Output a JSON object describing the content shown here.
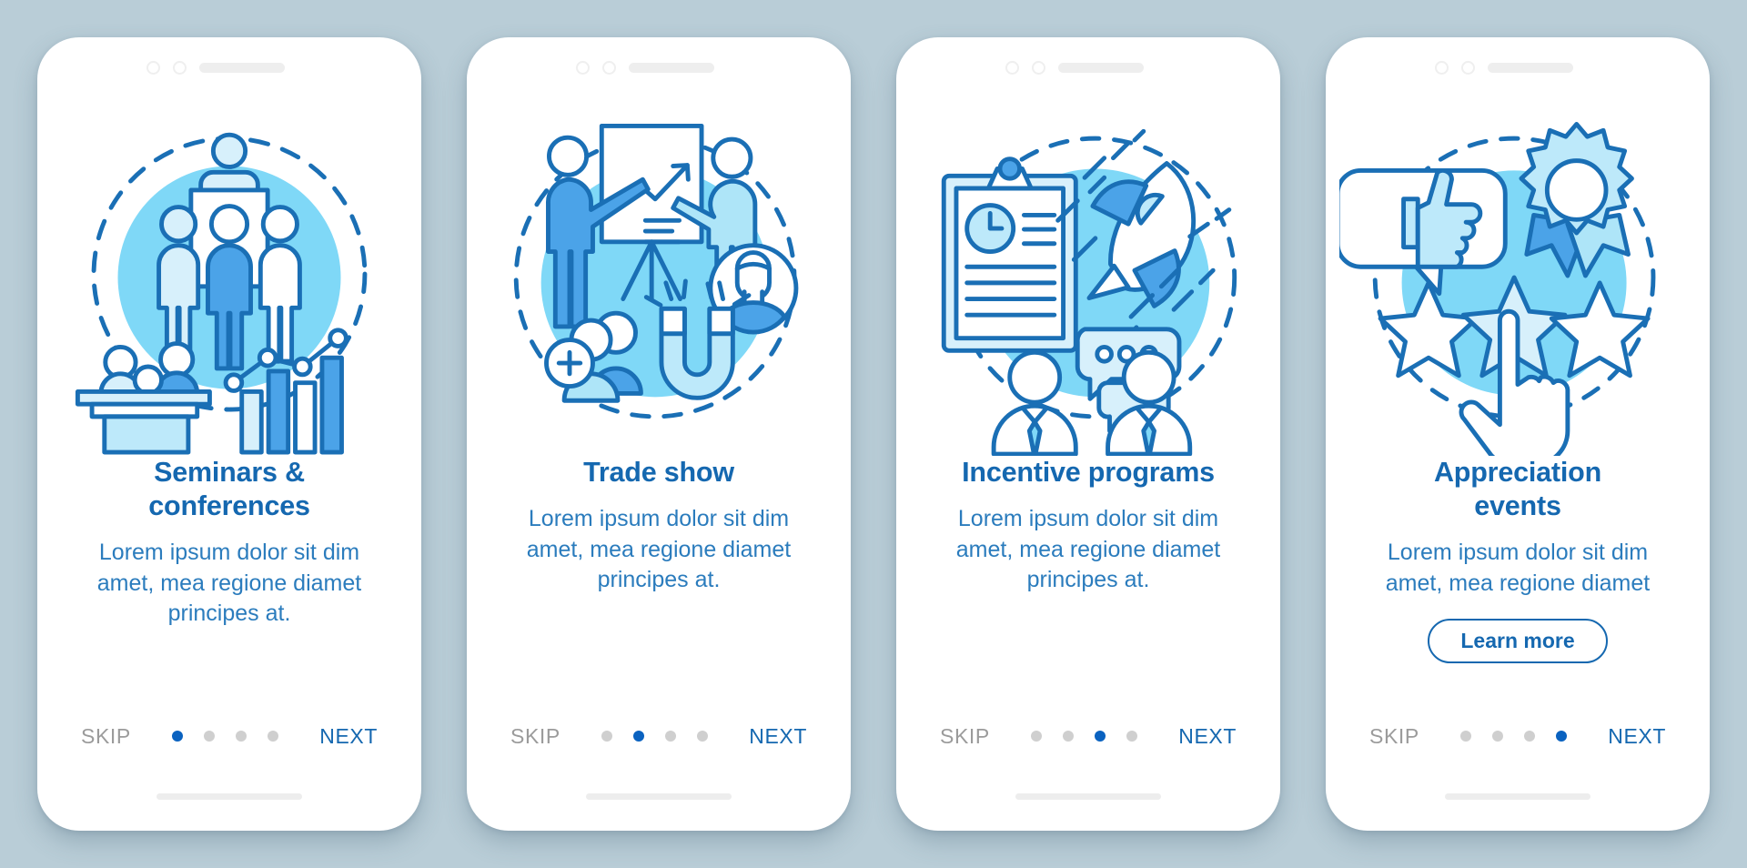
{
  "theme": {
    "background": "#b9cdd7",
    "card_background": "#ffffff",
    "accent": "#1568b0",
    "accent_bright": "#0a62c0",
    "body_text": "#2b7cbd",
    "muted_text": "#9b9b9b",
    "illustration_stroke": "#1a6fb5",
    "illustration_fill_light": "#d7f0fb",
    "illustration_fill_mid": "#7fd8f7",
    "illustration_fill_strong": "#4ba3e8"
  },
  "screens": [
    {
      "id": "seminars-conferences",
      "illustration": "seminars-conferences-illustration",
      "title": "Seminars & conferences",
      "title_lines": [
        "Seminars &",
        "conferences"
      ],
      "description": "Lorem ipsum dolor sit dim amet, mea regione diamet principes at.",
      "description_lines": [
        "Lorem ipsum dolor sit dim",
        "amet, mea regione diamet",
        "principes at."
      ],
      "skip_label": "SKIP",
      "next_label": "NEXT",
      "dots_total": 4,
      "dot_active_index": 0,
      "has_learn_more": false,
      "learn_more_label": ""
    },
    {
      "id": "trade-show",
      "illustration": "trade-show-illustration",
      "title": "Trade show",
      "title_lines": [
        "Trade show"
      ],
      "description": "Lorem ipsum dolor sit dim amet, mea regione diamet principes at.",
      "description_lines": [
        "Lorem ipsum dolor sit dim",
        "amet, mea regione diamet",
        "principes at."
      ],
      "skip_label": "SKIP",
      "next_label": "NEXT",
      "dots_total": 4,
      "dot_active_index": 1,
      "has_learn_more": false,
      "learn_more_label": ""
    },
    {
      "id": "incentive-programs",
      "illustration": "incentive-programs-illustration",
      "title": "Incentive programs",
      "title_lines": [
        "Incentive programs"
      ],
      "description": "Lorem ipsum dolor sit dim amet, mea regione diamet principes at.",
      "description_lines": [
        "Lorem ipsum dolor sit dim",
        "amet, mea regione diamet",
        "principes at."
      ],
      "skip_label": "SKIP",
      "next_label": "NEXT",
      "dots_total": 4,
      "dot_active_index": 2,
      "has_learn_more": false,
      "learn_more_label": ""
    },
    {
      "id": "appreciation-events",
      "illustration": "appreciation-events-illustration",
      "title": "Appreciation events",
      "title_lines": [
        "Appreciation",
        "events"
      ],
      "description": "Lorem ipsum dolor sit dim amet, mea regione diamet",
      "description_lines": [
        "Lorem ipsum dolor sit dim",
        "amet, mea regione diamet"
      ],
      "skip_label": "SKIP",
      "next_label": "NEXT",
      "dots_total": 4,
      "dot_active_index": 3,
      "has_learn_more": true,
      "learn_more_label": "Learn more"
    }
  ]
}
